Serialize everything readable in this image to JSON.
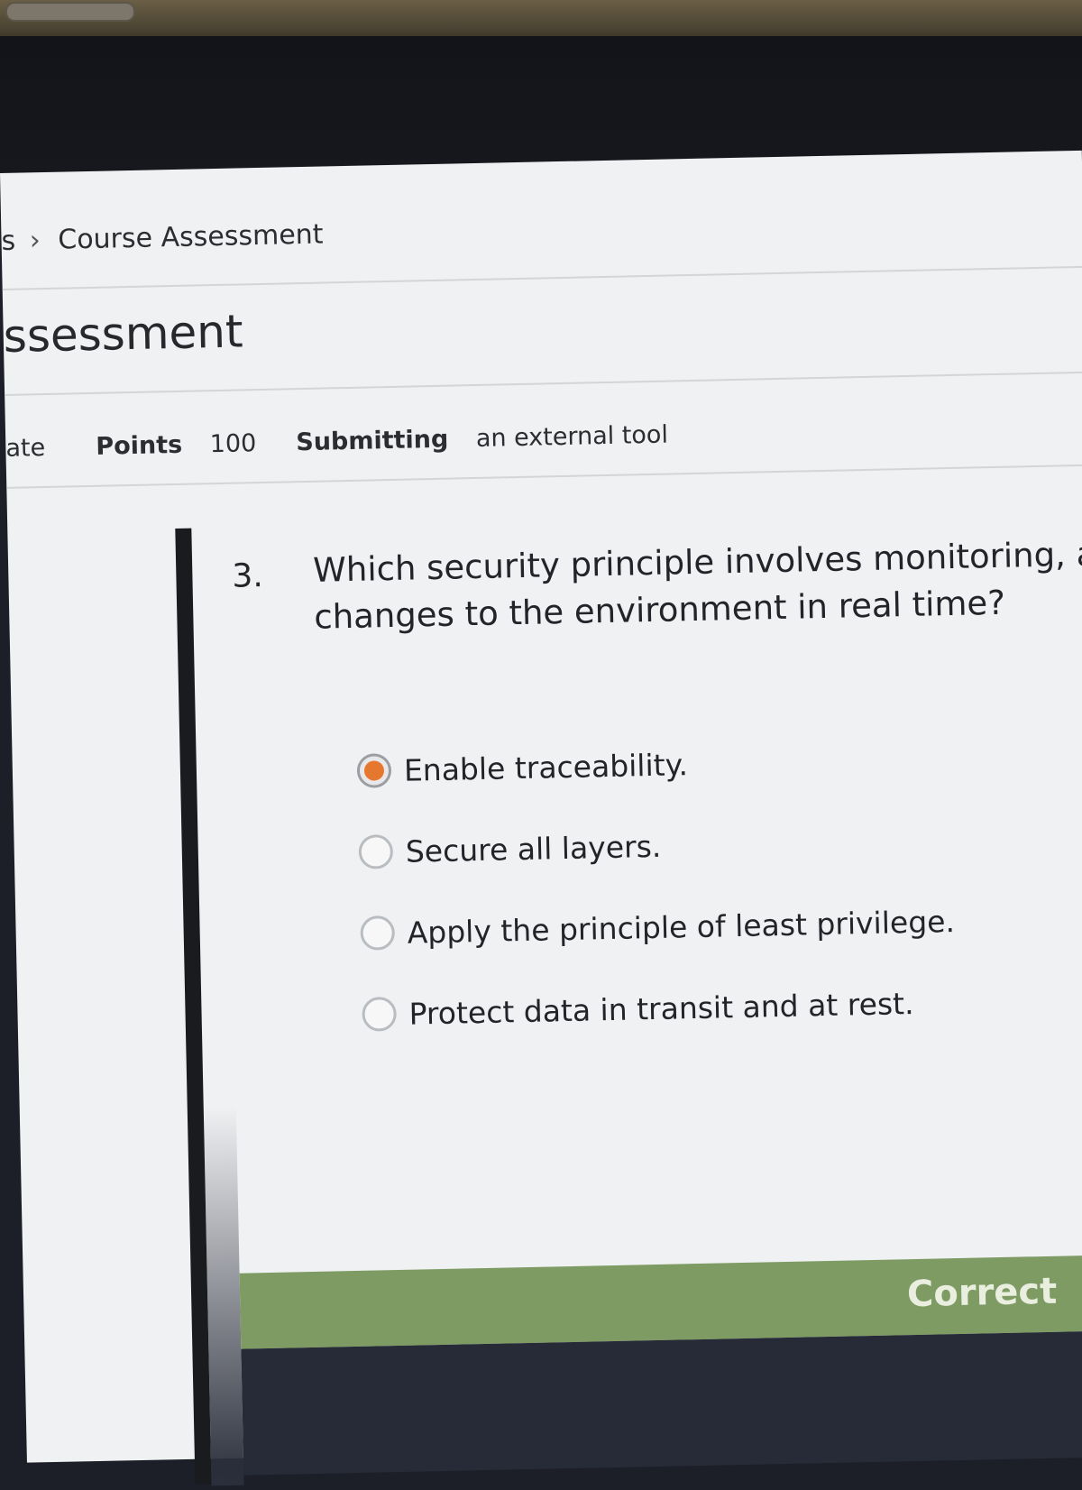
{
  "breadcrumb": {
    "prefix": "s",
    "separator": "›",
    "current": "Course Assessment"
  },
  "page": {
    "title": "ssessment"
  },
  "meta": {
    "due_fragment": "ate",
    "points_label": "Points",
    "points_value": "100",
    "submitting_label": "Submitting",
    "submitting_value": "an external tool"
  },
  "question": {
    "number": "3.",
    "text_line1": "Which security principle involves monitoring, al",
    "text_line2": "changes to the environment in real time?",
    "answers": [
      {
        "label": "Enable traceability.",
        "selected": true
      },
      {
        "label": "Secure all layers.",
        "selected": false
      },
      {
        "label": "Apply the principle of least privilege.",
        "selected": false
      },
      {
        "label": "Protect data in transit and at rest.",
        "selected": false
      }
    ],
    "result": "Correct"
  },
  "colors": {
    "selected_radio": "#e5772e",
    "correct_banner": "#7e9b64",
    "page_background": "#f0f1f3"
  }
}
